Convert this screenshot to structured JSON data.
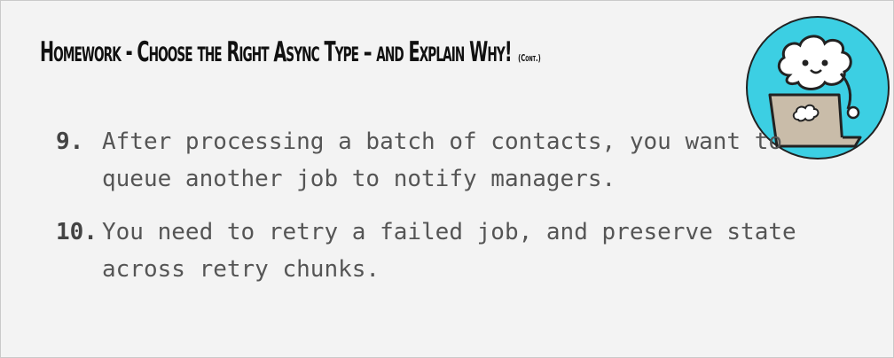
{
  "slide": {
    "title": "Homework - Choose the Right Async Type – and Explain Why!",
    "title_suffix": "(Cont.)",
    "items": [
      {
        "number": "9.",
        "text": "After processing a batch of contacts, you want to queue another job to notify managers."
      },
      {
        "number": "10.",
        "text": "You need to retry a failed job, and preserve state across retry chunks."
      }
    ]
  },
  "colors": {
    "avatar_circle": "#3ccfe3",
    "laptop": "#c9bca9",
    "background": "#f3f3f3"
  },
  "icons": {
    "avatar": "cloud-character-laptop-icon"
  }
}
